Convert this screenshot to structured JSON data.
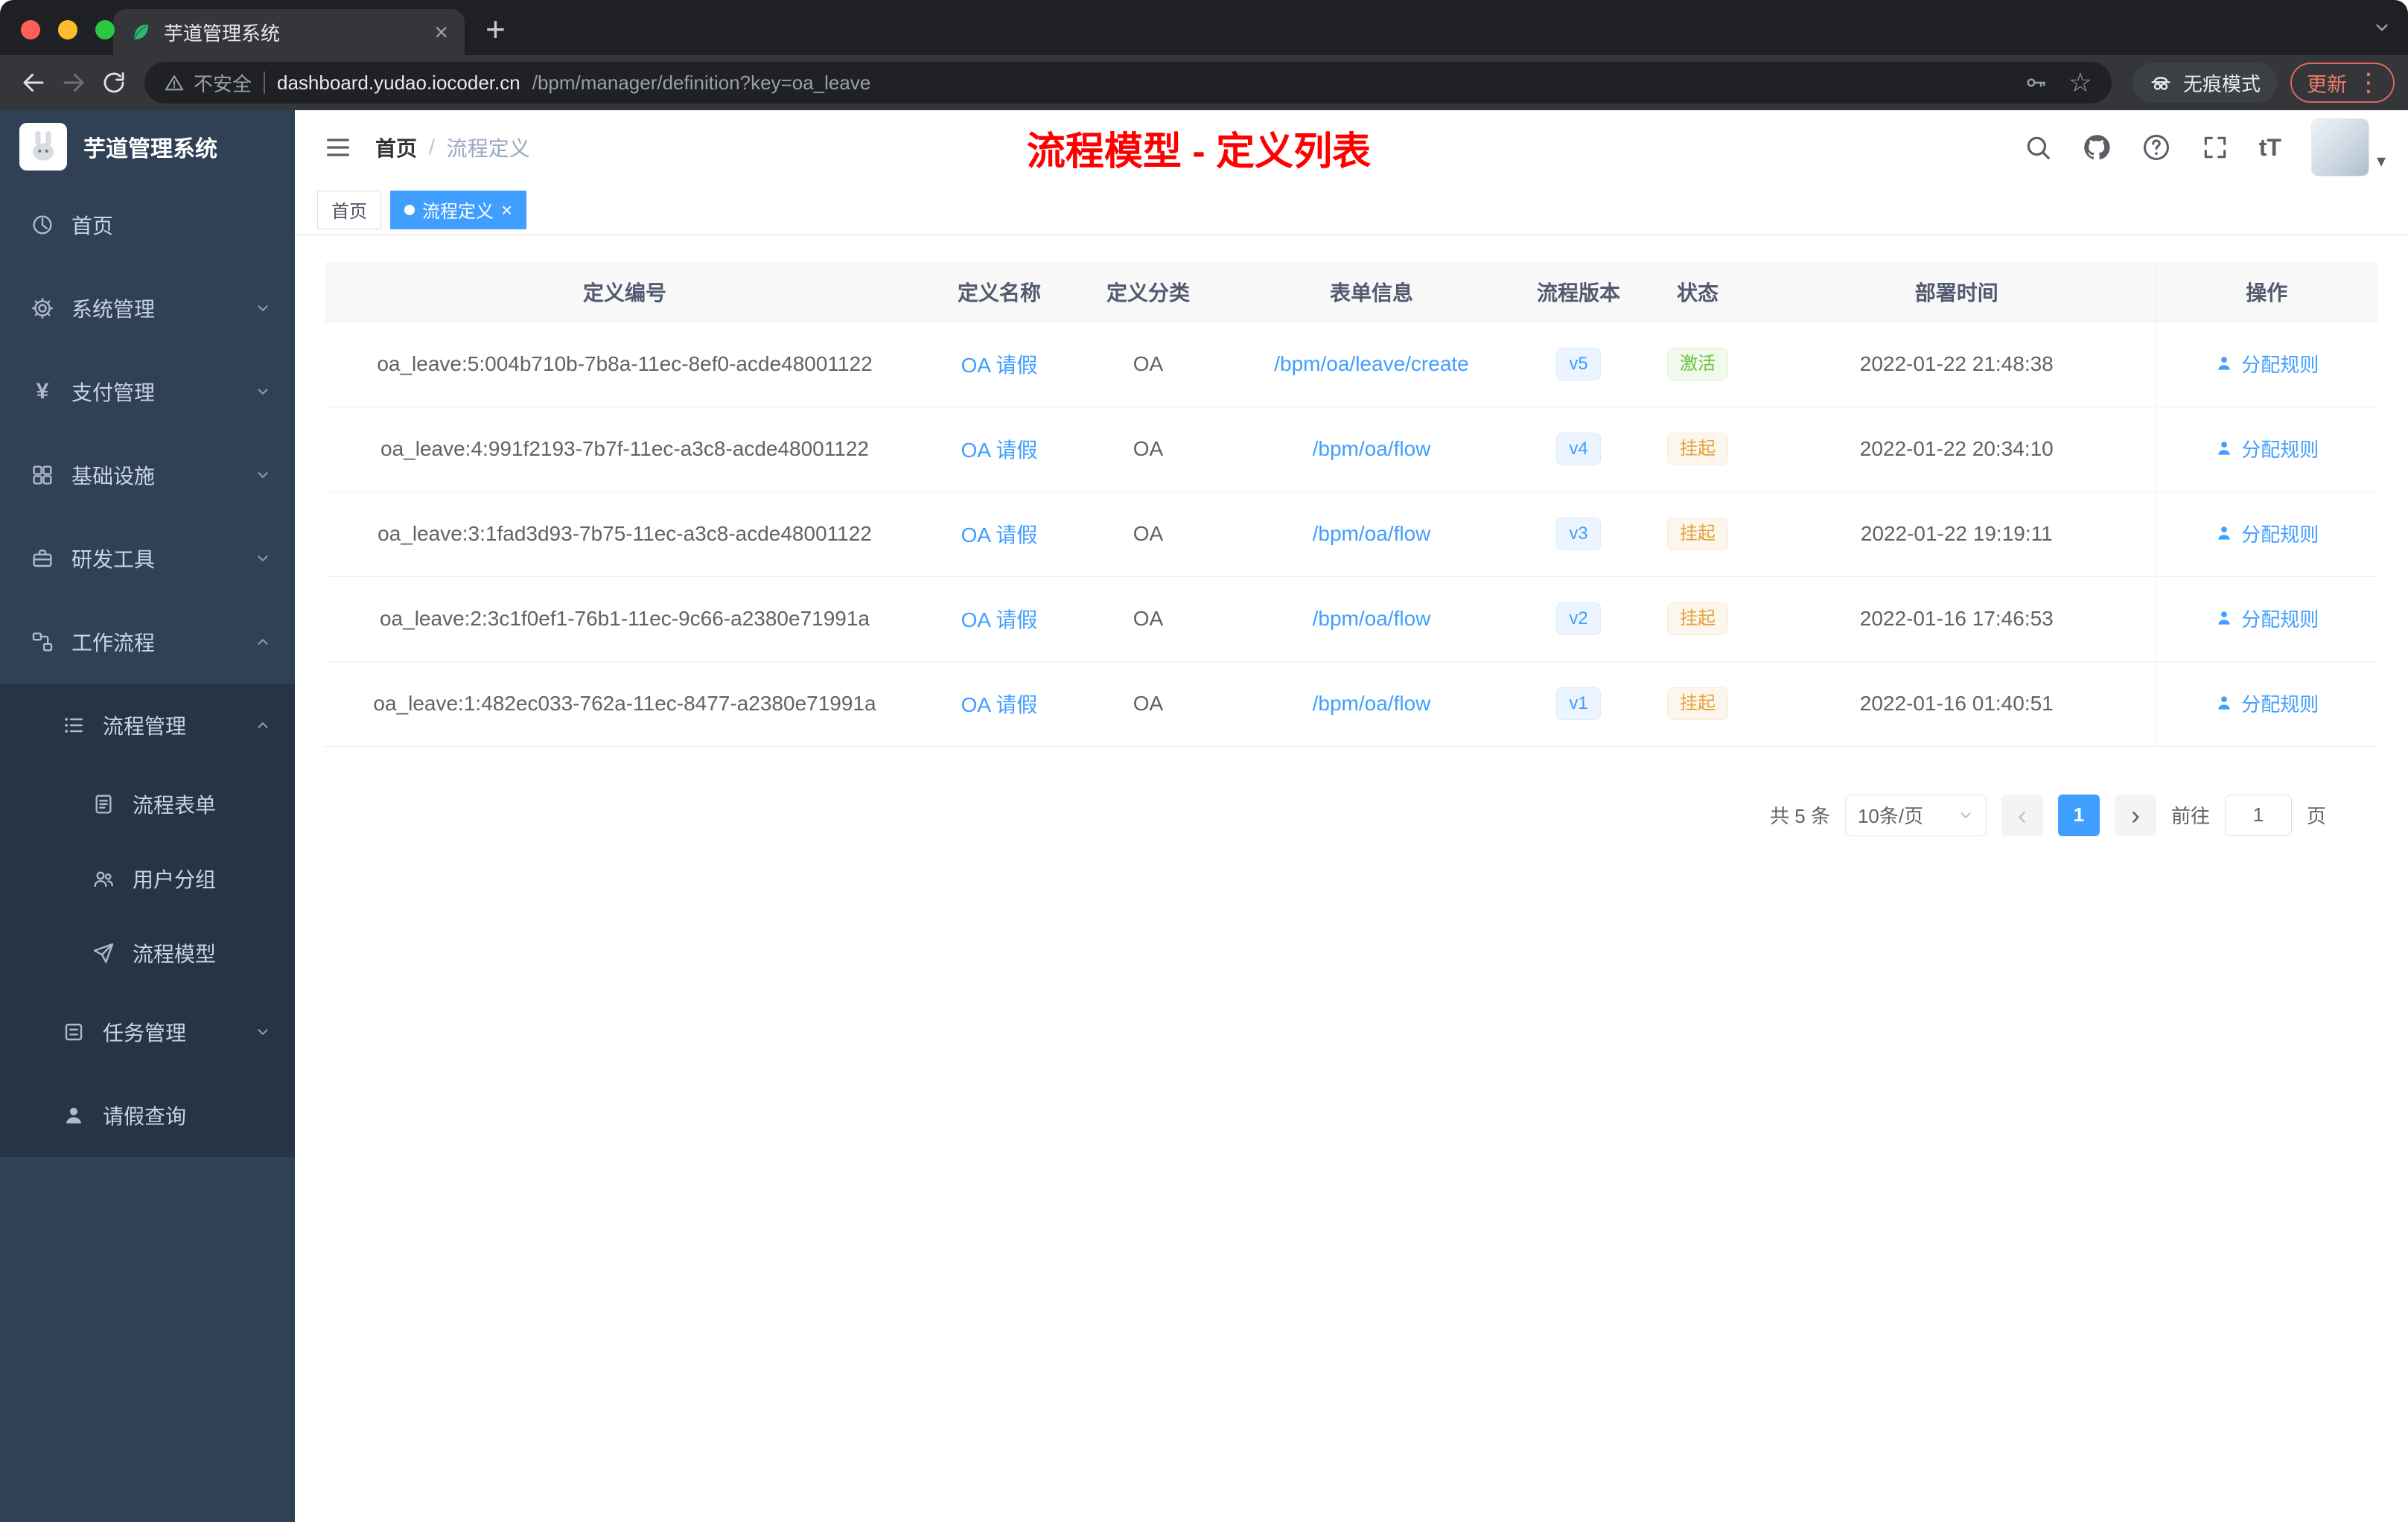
{
  "browser": {
    "tab_title": "芋道管理系统",
    "security_label": "不安全",
    "url_host": "dashboard.yudao.iocoder.cn",
    "url_path": "/bpm/manager/definition?key=oa_leave",
    "incognito_label": "无痕模式",
    "update_label": "更新"
  },
  "icons": {
    "close": "×",
    "plus": "+",
    "more_vertical": "⋮",
    "star": "☆",
    "prev": "‹",
    "next": "›",
    "caret_down": "▾",
    "font_size": "tT",
    "yen": "¥"
  },
  "sidebar": {
    "app_title": "芋道管理系统",
    "items": [
      {
        "label": "首页",
        "icon": "dashboard-icon"
      },
      {
        "label": "系统管理",
        "icon": "gear-icon"
      },
      {
        "label": "支付管理",
        "icon": "yen-icon"
      },
      {
        "label": "基础设施",
        "icon": "infrastructure-icon"
      },
      {
        "label": "研发工具",
        "icon": "dev-tools-icon"
      },
      {
        "label": "工作流程",
        "icon": "workflow-icon"
      },
      {
        "label": "流程管理",
        "icon": "process-list-icon"
      },
      {
        "label": "流程表单",
        "icon": "form-icon"
      },
      {
        "label": "用户分组",
        "icon": "user-group-icon"
      },
      {
        "label": "流程模型",
        "icon": "send-icon"
      },
      {
        "label": "任务管理",
        "icon": "task-icon"
      },
      {
        "label": "请假查询",
        "icon": "person-icon"
      }
    ]
  },
  "header": {
    "breadcrumb_home": "首页",
    "breadcrumb_current": "流程定义",
    "page_title": "流程模型 - 定义列表"
  },
  "tags": {
    "home": "首页",
    "active": "流程定义"
  },
  "table": {
    "headers": [
      "定义编号",
      "定义名称",
      "定义分类",
      "表单信息",
      "流程版本",
      "状态",
      "部署时间",
      "操作"
    ],
    "action_label": "分配规则",
    "rows": [
      {
        "id": "oa_leave:5:004b710b-7b8a-11ec-8ef0-acde48001122",
        "name": "OA 请假",
        "category": "OA",
        "form": "/bpm/oa/leave/create",
        "version": "v5",
        "status": "激活",
        "status_type": "success",
        "deploy_time": "2022-01-22 21:48:38"
      },
      {
        "id": "oa_leave:4:991f2193-7b7f-11ec-a3c8-acde48001122",
        "name": "OA 请假",
        "category": "OA",
        "form": "/bpm/oa/flow",
        "version": "v4",
        "status": "挂起",
        "status_type": "warning",
        "deploy_time": "2022-01-22 20:34:10"
      },
      {
        "id": "oa_leave:3:1fad3d93-7b75-11ec-a3c8-acde48001122",
        "name": "OA 请假",
        "category": "OA",
        "form": "/bpm/oa/flow",
        "version": "v3",
        "status": "挂起",
        "status_type": "warning",
        "deploy_time": "2022-01-22 19:19:11"
      },
      {
        "id": "oa_leave:2:3c1f0ef1-76b1-11ec-9c66-a2380e71991a",
        "name": "OA 请假",
        "category": "OA",
        "form": "/bpm/oa/flow",
        "version": "v2",
        "status": "挂起",
        "status_type": "warning",
        "deploy_time": "2022-01-16 17:46:53"
      },
      {
        "id": "oa_leave:1:482ec033-762a-11ec-8477-a2380e71991a",
        "name": "OA 请假",
        "category": "OA",
        "form": "/bpm/oa/flow",
        "version": "v1",
        "status": "挂起",
        "status_type": "warning",
        "deploy_time": "2022-01-16 01:40:51"
      }
    ]
  },
  "pagination": {
    "total": "共 5 条",
    "page_size": "10条/页",
    "current_page": "1",
    "goto_label": "前往",
    "goto_value": "1",
    "unit_label": "页"
  },
  "colors": {
    "accent_blue": "#409eff",
    "title_red": "#ff0000",
    "success_green": "#67c23a",
    "warning_orange": "#e6a23c",
    "sidebar_bg": "#304156",
    "submenu_bg": "#263445"
  }
}
